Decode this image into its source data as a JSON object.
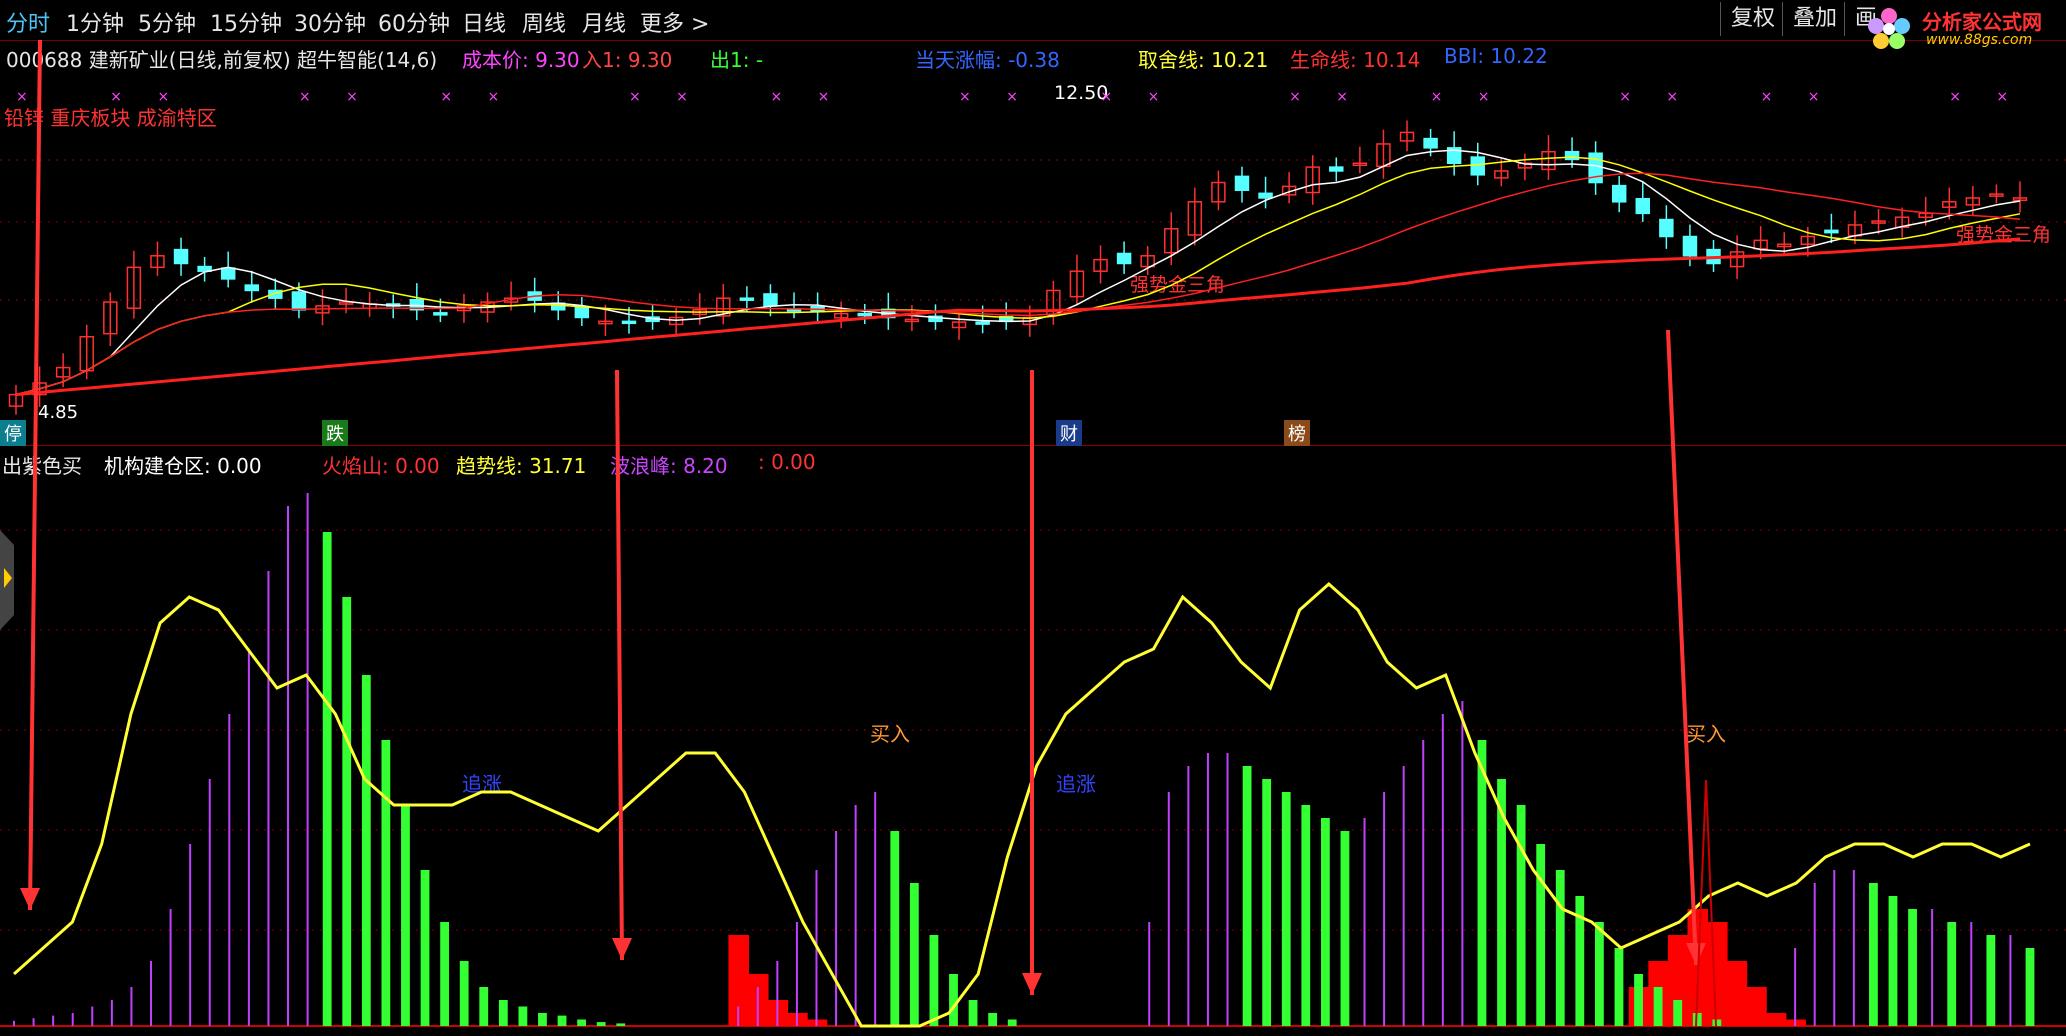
{
  "toolbar": {
    "timeframes": [
      "分时",
      "1分钟",
      "5分钟",
      "15分钟",
      "30分钟",
      "60分钟",
      "日线",
      "周线",
      "月线",
      "更多 >"
    ],
    "active_index": 0,
    "right_buttons": [
      "复权",
      "叠加",
      "画"
    ],
    "logo_text": "分析家公式网",
    "logo_url": "www.88gs.com"
  },
  "upper": {
    "stock_title": "000688 建新矿业(日线,前复权) 超牛智能(14,6)",
    "cost_label": "成本价: 9.30",
    "in_label": "入1: 9.30",
    "out_label": "出1: -",
    "today_change_label": "当天涨幅: -0.38",
    "qushe_label": "取舍线: 10.21",
    "life_label": "生命线: 10.14",
    "bbi_label": "BBI: 10.22",
    "sector_label": "铅锌 重庆板块 成渝特区",
    "high_label": "12.50",
    "low_label": "4.85",
    "triangle_labels": [
      "强势金三角",
      "强势金三角"
    ],
    "event_tags": [
      "停",
      "跌",
      "财",
      "榜"
    ]
  },
  "lower": {
    "legend_1": "出紫色买",
    "legend_2": "机构建仓区: 0.00",
    "legend_3": "火焰山: 0.00",
    "legend_4": "趋势线: 31.71",
    "legend_5": "波浪峰: 8.20",
    "legend_6": ": 0.00",
    "zhuizhang_labels": [
      "追涨",
      "追涨"
    ],
    "mairu_labels": [
      "买入",
      "买入"
    ]
  },
  "colors": {
    "up": "#ff3030",
    "down": "#55ffff",
    "ma_white": "#ffffff",
    "ma_yellow": "#ffff00",
    "ma_red": "#ff2020",
    "purple": "#c040ff",
    "green": "#33ff33",
    "flame": "#ff0000",
    "trend": "#ffff33",
    "grid": "#8b0000"
  },
  "chart_data": [
    {
      "type": "candlestick",
      "title": "000688 建新矿业(日线,前复权)",
      "close": [
        4.9,
        5.2,
        5.6,
        6.4,
        7.3,
        8.2,
        8.5,
        8.3,
        8.1,
        7.9,
        7.6,
        7.4,
        7.1,
        7.2,
        7.3,
        7.25,
        7.2,
        7.1,
        7.0,
        7.2,
        7.3,
        7.4,
        7.35,
        7.1,
        6.9,
        6.8,
        6.75,
        6.8,
        6.9,
        7.1,
        7.4,
        7.35,
        7.2,
        7.1,
        7.05,
        7.0,
        6.95,
        6.9,
        6.85,
        6.8,
        6.78,
        6.76,
        6.8,
        6.9,
        7.6,
        8.1,
        8.4,
        8.3,
        8.5,
        9.2,
        9.9,
        10.4,
        10.2,
        10.0,
        10.3,
        10.8,
        10.7,
        10.9,
        11.4,
        11.7,
        11.3,
        10.9,
        10.6,
        10.7,
        10.9,
        11.2,
        11.0,
        10.4,
        9.9,
        9.6,
        9.0,
        8.5,
        8.3,
        8.6,
        8.9,
        8.8,
        9.0,
        9.1,
        9.3,
        9.4,
        9.5,
        9.6,
        9.9,
        10.0,
        10.1,
        10.0
      ],
      "ma_yellow_ylim": [
        4.5,
        12.8
      ],
      "high_marker": 12.5,
      "low_marker": 4.85
    },
    {
      "type": "bar",
      "title": "超牛智能",
      "series": [
        {
          "name": "出紫色买",
          "values": [
            0.4,
            0.6,
            0.8,
            1,
            1.5,
            2,
            3,
            5,
            9,
            14,
            19,
            24,
            29,
            35,
            40,
            41,
            38,
            33,
            27,
            22,
            17,
            12,
            8,
            5,
            3,
            2,
            1.5,
            1,
            0.8,
            0.5,
            0.3,
            0.2,
            0,
            0,
            0,
            0,
            0,
            1.5,
            3,
            5,
            8,
            12,
            15,
            17,
            18,
            15,
            11,
            7,
            4,
            2,
            1,
            0.5,
            0,
            0,
            0,
            0,
            0,
            0,
            8,
            18,
            20,
            21,
            21,
            20,
            19,
            18,
            17,
            16,
            15,
            16,
            18,
            20,
            22,
            24,
            25,
            22,
            19,
            17,
            14,
            12,
            10,
            8,
            6,
            4,
            3,
            2,
            1,
            0.5,
            0,
            0,
            0,
            6,
            11,
            12,
            12,
            11,
            10,
            9,
            9,
            8,
            8,
            7,
            7,
            6
          ]
        },
        {
          "name": "火焰山",
          "values": [
            0,
            0,
            0,
            0,
            0,
            0,
            0,
            0,
            0,
            0,
            0,
            0,
            0,
            0,
            0,
            0,
            0,
            0,
            0,
            0,
            0,
            0,
            0,
            0,
            0,
            0,
            0,
            0,
            0,
            0,
            0,
            0,
            0,
            0,
            0,
            0,
            0,
            7,
            4,
            2,
            1,
            0.5,
            0,
            0,
            0,
            0,
            0,
            0,
            0,
            0,
            0,
            0,
            0,
            0,
            0,
            0,
            0,
            0,
            0,
            0,
            0,
            0,
            0,
            0,
            0,
            0,
            0,
            0,
            0,
            0,
            0,
            0,
            0,
            0,
            0,
            0,
            0,
            0,
            0,
            0,
            0,
            0,
            0,
            3,
            5,
            7,
            9,
            8,
            5,
            3,
            1,
            0.5,
            0,
            0,
            0,
            0,
            0,
            0,
            0,
            0,
            0,
            0,
            0,
            0,
            0,
            0,
            0
          ]
        },
        {
          "name": "趋势线",
          "values": [
            4,
            6,
            8,
            14,
            24,
            31,
            33,
            32,
            29,
            26,
            27,
            24,
            19,
            17,
            17,
            17,
            18,
            18,
            17,
            16,
            15,
            17,
            19,
            21,
            21,
            18,
            13,
            8,
            4,
            0,
            -1,
            0,
            1,
            4,
            13,
            20,
            24,
            26,
            28,
            29,
            33,
            31,
            28,
            26,
            32,
            34,
            32,
            28,
            26,
            27,
            21,
            16,
            12,
            9,
            8,
            6,
            7,
            8,
            10,
            11,
            10,
            11,
            13,
            14,
            14,
            13,
            14,
            14,
            13,
            14
          ]
        }
      ],
      "ylim": [
        0,
        42
      ]
    }
  ]
}
